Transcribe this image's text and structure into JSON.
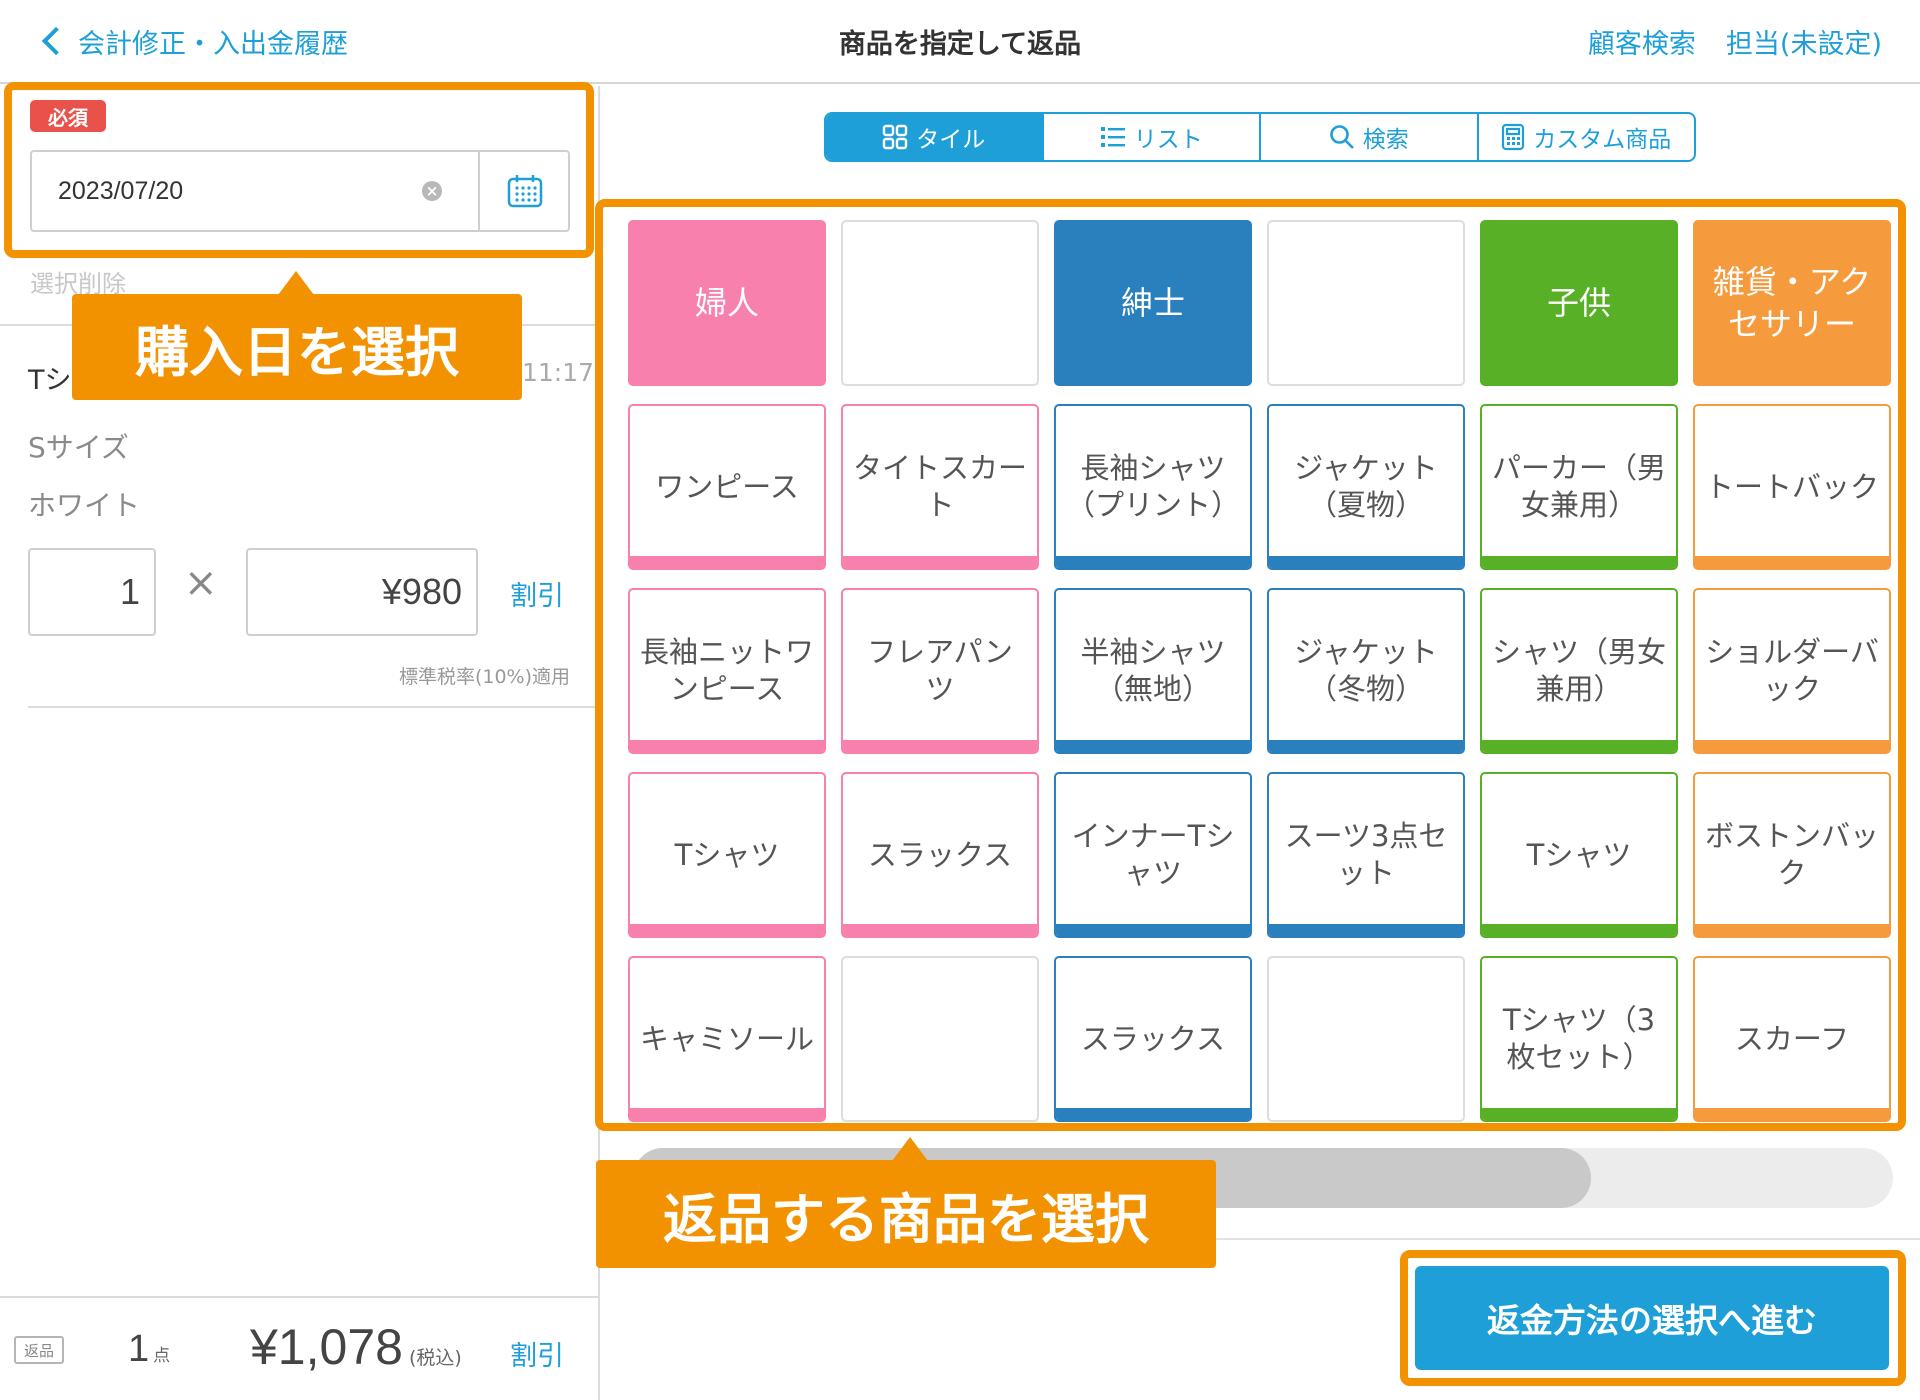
{
  "header": {
    "back_label": "会計修正・入出金履歴",
    "title": "商品を指定して返品",
    "customer_search": "顧客検索",
    "staff": "担当(未設定)"
  },
  "left": {
    "required_badge": "必須",
    "date_value": "2023/07/20",
    "clear_selection": "選択削除",
    "item": {
      "name": "Tシャツ",
      "time": "11:17",
      "size": "Sサイズ",
      "color": "ホワイト",
      "quantity": "1",
      "times_sign": "×",
      "unit_price": "¥980",
      "discount_label": "割引",
      "tax_note": "標準税率(10%)適用"
    },
    "footer": {
      "return_badge": "返品",
      "count": "1",
      "count_unit": "点",
      "total": "¥1,078",
      "tax_included": "(税込)",
      "discount_label": "割引"
    }
  },
  "view_tabs": [
    {
      "label": "タイル",
      "icon": "grid-icon",
      "active": true
    },
    {
      "label": "リスト",
      "icon": "list-icon",
      "active": false
    },
    {
      "label": "検索",
      "icon": "search-icon",
      "active": false
    },
    {
      "label": "カスタム商品",
      "icon": "calculator-icon",
      "active": false
    }
  ],
  "colors": {
    "women": "#f780ad",
    "men": "#2a80bd",
    "kids": "#57b025",
    "goods": "#f59b3d",
    "accent": "#1e9fd8",
    "annotation": "#f39200"
  },
  "tiles": [
    [
      {
        "label": "婦人",
        "type": "category",
        "group": "women"
      },
      {
        "label": "",
        "type": "empty"
      },
      {
        "label": "紳士",
        "type": "category",
        "group": "men"
      },
      {
        "label": "",
        "type": "empty"
      },
      {
        "label": "子供",
        "type": "category",
        "group": "kids"
      },
      {
        "label": "雑貨・アクセサリー",
        "type": "category",
        "group": "goods"
      }
    ],
    [
      {
        "label": "ワンピース",
        "type": "product",
        "group": "women"
      },
      {
        "label": "タイトスカート",
        "type": "product",
        "group": "women"
      },
      {
        "label": "長袖シャツ（プリント）",
        "type": "product",
        "group": "men"
      },
      {
        "label": "ジャケット（夏物）",
        "type": "product",
        "group": "men"
      },
      {
        "label": "パーカー（男女兼用）",
        "type": "product",
        "group": "kids"
      },
      {
        "label": "トートバック",
        "type": "product",
        "group": "goods"
      }
    ],
    [
      {
        "label": "長袖ニットワンピース",
        "type": "product",
        "group": "women"
      },
      {
        "label": "フレアパンツ",
        "type": "product",
        "group": "women"
      },
      {
        "label": "半袖シャツ（無地）",
        "type": "product",
        "group": "men"
      },
      {
        "label": "ジャケット（冬物）",
        "type": "product",
        "group": "men"
      },
      {
        "label": "シャツ（男女兼用）",
        "type": "product",
        "group": "kids"
      },
      {
        "label": "ショルダーバック",
        "type": "product",
        "group": "goods"
      }
    ],
    [
      {
        "label": "Tシャツ",
        "type": "product",
        "group": "women"
      },
      {
        "label": "スラックス",
        "type": "product",
        "group": "women"
      },
      {
        "label": "インナーTシャツ",
        "type": "product",
        "group": "men"
      },
      {
        "label": "スーツ3点セット",
        "type": "product",
        "group": "men"
      },
      {
        "label": "Tシャツ",
        "type": "product",
        "group": "kids"
      },
      {
        "label": "ボストンバック",
        "type": "product",
        "group": "goods"
      }
    ],
    [
      {
        "label": "キャミソール",
        "type": "product",
        "group": "women"
      },
      {
        "label": "",
        "type": "empty"
      },
      {
        "label": "スラックス",
        "type": "product",
        "group": "men"
      },
      {
        "label": "",
        "type": "empty"
      },
      {
        "label": "Tシャツ（3枚セット）",
        "type": "product",
        "group": "kids"
      },
      {
        "label": "スカーフ",
        "type": "product",
        "group": "goods"
      }
    ]
  ],
  "scroll_position": 0.76,
  "proceed_button": "返金方法の選択へ進む",
  "annotations": {
    "purchase_date": "購入日を選択",
    "select_products": "返品する商品を選択"
  }
}
